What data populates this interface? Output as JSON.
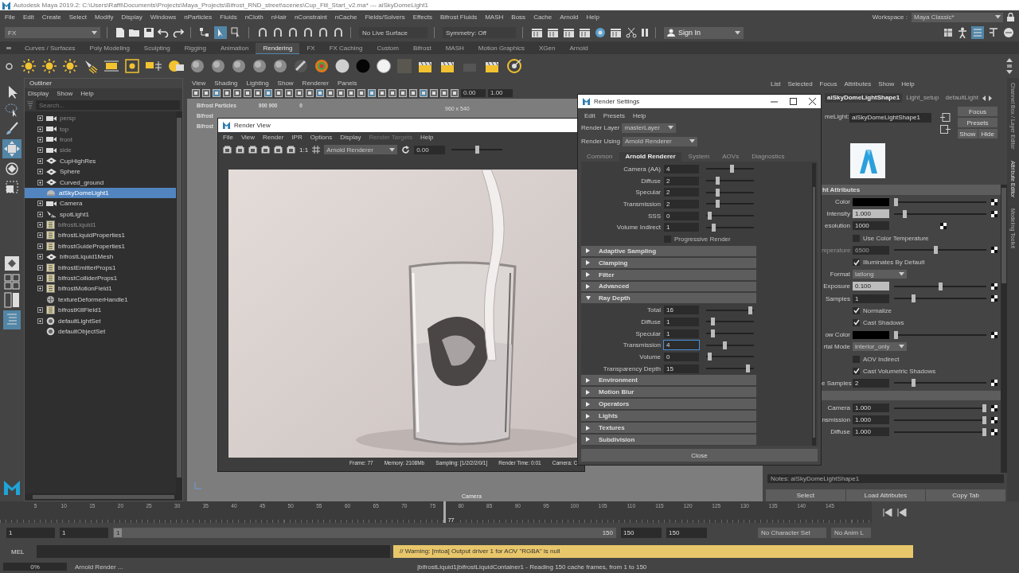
{
  "window": {
    "title": "Autodesk Maya 2019.2: C:\\Users\\Raffi\\Documents\\Projects\\Maya_Projects\\Bifrost_RND_street\\scenes\\Cup_Fill_Start_v2.ma*   ---   aiSkyDomeLight1"
  },
  "menu": [
    "File",
    "Edit",
    "Create",
    "Select",
    "Modify",
    "Display",
    "Windows",
    "nParticles",
    "Fluids",
    "nCloth",
    "nHair",
    "nConstraint",
    "nCache",
    "Fields/Solvers",
    "Effects",
    "Bifrost Fluids",
    "MASH",
    "Boss",
    "Cache",
    "Arnold",
    "Help"
  ],
  "workspace": {
    "label": "Workspace :",
    "value": "Maya Classic*"
  },
  "status_line": {
    "mode": "FX",
    "live_surface": "No Live Surface",
    "symmetry": "Symmetry: Off",
    "sign_in": "Sign In"
  },
  "shelf_tabs": [
    {
      "label": "Curves / Surfaces",
      "selected": false
    },
    {
      "label": "Poly Modeling",
      "selected": false
    },
    {
      "label": "Sculpting",
      "selected": false
    },
    {
      "label": "Rigging",
      "selected": false
    },
    {
      "label": "Animation",
      "selected": false
    },
    {
      "label": "Rendering",
      "selected": true
    },
    {
      "label": "FX",
      "selected": false
    },
    {
      "label": "FX Caching",
      "selected": false
    },
    {
      "label": "Custom",
      "selected": false
    },
    {
      "label": "Bifrost",
      "selected": false
    },
    {
      "label": "MASH",
      "selected": false
    },
    {
      "label": "Motion Graphics",
      "selected": false
    },
    {
      "label": "XGen",
      "selected": false
    },
    {
      "label": "Arnold",
      "selected": false
    }
  ],
  "outliner": {
    "title": "Outliner",
    "menu": [
      "Display",
      "Show",
      "Help"
    ],
    "search": {
      "placeholder": "Search..."
    },
    "items": [
      {
        "label": "persp",
        "kind": "camera",
        "dim": true,
        "selected": false,
        "expandable": true
      },
      {
        "label": "top",
        "kind": "camera",
        "dim": true,
        "selected": false,
        "expandable": true
      },
      {
        "label": "front",
        "kind": "camera",
        "dim": true,
        "selected": false,
        "expandable": true
      },
      {
        "label": "side",
        "kind": "camera",
        "dim": true,
        "selected": false,
        "expandable": true
      },
      {
        "label": "CupHighRes",
        "kind": "mesh",
        "dim": false,
        "selected": false,
        "expandable": true
      },
      {
        "label": "Sphere",
        "kind": "mesh",
        "dim": false,
        "selected": false,
        "expandable": true
      },
      {
        "label": "Curved_ground",
        "kind": "mesh",
        "dim": false,
        "selected": false,
        "expandable": true
      },
      {
        "label": "aiSkyDomeLight1",
        "kind": "dome",
        "dim": false,
        "selected": true,
        "expandable": false
      },
      {
        "label": "Camera",
        "kind": "camera",
        "dim": false,
        "selected": false,
        "expandable": true
      },
      {
        "label": "spotLight1",
        "kind": "spot",
        "dim": false,
        "selected": false,
        "expandable": true
      },
      {
        "label": "bifrostLiquid1",
        "kind": "bifrost",
        "dim": true,
        "selected": false,
        "expandable": true
      },
      {
        "label": "bifrostLiquidProperties1",
        "kind": "bifrost",
        "dim": false,
        "selected": false,
        "expandable": true
      },
      {
        "label": "bifrostGuideProperties1",
        "kind": "bifrost",
        "dim": false,
        "selected": false,
        "expandable": true
      },
      {
        "label": "bifrostLiquid1Mesh",
        "kind": "mesh",
        "dim": false,
        "selected": false,
        "expandable": true
      },
      {
        "label": "bifrostEmitterProps1",
        "kind": "bifrost",
        "dim": false,
        "selected": false,
        "expandable": true
      },
      {
        "label": "bifrostColliderProps1",
        "kind": "bifrost",
        "dim": false,
        "selected": false,
        "expandable": true
      },
      {
        "label": "bifrostMotionField1",
        "kind": "bifrost",
        "dim": false,
        "selected": false,
        "expandable": true
      },
      {
        "label": "textureDeformerHandle1",
        "kind": "handle",
        "dim": false,
        "selected": false,
        "expandable": false
      },
      {
        "label": "bifrostKillField1",
        "kind": "bifrost",
        "dim": false,
        "selected": false,
        "expandable": true
      },
      {
        "label": "defaultLightSet",
        "kind": "set",
        "dim": false,
        "selected": false,
        "expandable": true
      },
      {
        "label": "defaultObjectSet",
        "kind": "set",
        "dim": false,
        "selected": false,
        "expandable": false
      }
    ]
  },
  "viewport": {
    "menu": [
      "View",
      "Shading",
      "Lighting",
      "Show",
      "Renderer",
      "Panels"
    ],
    "fields": [
      "0.00",
      "1.00"
    ],
    "hud": [
      {
        "label": "Bifrost Particles",
        "values": [
          "900 900",
          "0"
        ]
      },
      {
        "label": "Bifrost"
      },
      {
        "label": "Bifrost"
      }
    ],
    "resolution": "960 x 540",
    "camera": "Camera"
  },
  "render_view": {
    "title": "Render View",
    "menu": [
      {
        "label": "File",
        "disabled": false
      },
      {
        "label": "View",
        "disabled": false
      },
      {
        "label": "Render",
        "disabled": false
      },
      {
        "label": "IPR",
        "disabled": false
      },
      {
        "label": "Options",
        "disabled": false
      },
      {
        "label": "Display",
        "disabled": false
      },
      {
        "label": "Render Targets",
        "disabled": true
      },
      {
        "label": "Help",
        "disabled": false
      }
    ],
    "ratio": "1:1",
    "renderer": "Arnold Renderer",
    "value": "0.00",
    "level": 0.5,
    "status": [
      "Frame: 77",
      "Memory: 2108Mb",
      "Sampling: [1/2/2/2/0/1]",
      "Render Time: 0:01",
      "Camera: C"
    ]
  },
  "render_settings": {
    "title": "Render Settings",
    "menu": [
      "Edit",
      "Presets",
      "Help"
    ],
    "layer": {
      "label": "Render Layer",
      "value": "masterLayer"
    },
    "using": {
      "label": "Render Using",
      "value": "Arnold Renderer"
    },
    "tabs": [
      {
        "label": "Common",
        "selected": false
      },
      {
        "label": "Arnold Renderer",
        "selected": true
      },
      {
        "label": "System",
        "selected": false
      },
      {
        "label": "AOVs",
        "selected": false
      },
      {
        "label": "Diagnostics",
        "selected": false
      }
    ],
    "rows": [
      {
        "kind": "field",
        "label": "Camera (AA)",
        "value": "4",
        "level": 0.55,
        "focused": false
      },
      {
        "kind": "field",
        "label": "Diffuse",
        "value": "2",
        "level": 0.22,
        "focused": false
      },
      {
        "kind": "field",
        "label": "Specular",
        "value": "2",
        "level": 0.22,
        "focused": false
      },
      {
        "kind": "field",
        "label": "Transmission",
        "value": "2",
        "level": 0.22,
        "focused": false
      },
      {
        "kind": "field",
        "label": "SSS",
        "value": "0",
        "level": 0.03,
        "focused": false
      },
      {
        "kind": "field",
        "label": "Volume Indirect",
        "value": "1",
        "level": 0.13,
        "focused": false
      },
      {
        "kind": "checkbox",
        "label": "Progressive Render",
        "checked": false
      },
      {
        "kind": "section",
        "label": "Adaptive Sampling",
        "expanded": false
      },
      {
        "kind": "section",
        "label": "Clamping",
        "expanded": false
      },
      {
        "kind": "section",
        "label": "Filter",
        "expanded": false
      },
      {
        "kind": "section",
        "label": "Advanced",
        "expanded": false
      },
      {
        "kind": "section",
        "label": "Ray Depth",
        "expanded": true
      },
      {
        "kind": "field",
        "label": "Total",
        "value": "16",
        "level": 0.97,
        "focused": false
      },
      {
        "kind": "field",
        "label": "Diffuse",
        "value": "1",
        "level": 0.1,
        "focused": false
      },
      {
        "kind": "field",
        "label": "Specular",
        "value": "1",
        "level": 0.1,
        "focused": false
      },
      {
        "kind": "field",
        "label": "Transmission",
        "value": "4",
        "level": 0.38,
        "focused": true
      },
      {
        "kind": "field",
        "label": "Volume",
        "value": "0",
        "level": 0.03,
        "focused": false
      },
      {
        "kind": "field",
        "label": "Transparency Depth",
        "value": "15",
        "level": 0.9,
        "focused": false
      },
      {
        "kind": "section",
        "label": "Environment",
        "expanded": false
      },
      {
        "kind": "section",
        "label": "Motion Blur",
        "expanded": false
      },
      {
        "kind": "section",
        "label": "Operators",
        "expanded": false
      },
      {
        "kind": "section",
        "label": "Lights",
        "expanded": false
      },
      {
        "kind": "section",
        "label": "Textures",
        "expanded": false
      },
      {
        "kind": "section",
        "label": "Subdivision",
        "expanded": false
      }
    ],
    "close": "Close"
  },
  "attribute_editor": {
    "menu": [
      "List",
      "Selected",
      "Focus",
      "Attributes",
      "Show",
      "Help"
    ],
    "tabs": [
      {
        "label": "aiSkyDomeLightShape1",
        "selected": true
      },
      {
        "label": "Light_setup",
        "selected": false
      },
      {
        "label": "defaultLight",
        "selected": false
      }
    ],
    "node": {
      "label": "meLight:",
      "value": "aiSkyDomeLightShape1"
    },
    "buttons": [
      "Focus",
      "Presets",
      "Show",
      "Hide"
    ],
    "section": "ht Attributes",
    "rows": [
      {
        "kind": "color",
        "label": "Color",
        "color": "#000000",
        "level": 0.0
      },
      {
        "kind": "field",
        "label": "Intensity",
        "value": "1.000",
        "level": 0.1,
        "connected": true,
        "disabled": false
      },
      {
        "kind": "field",
        "label": "esolution",
        "value": "1000",
        "connected": false,
        "disabled": false
      },
      {
        "kind": "checkbox",
        "label": "Use Color Temperature",
        "checked": false
      },
      {
        "kind": "field",
        "label": "mperature",
        "value": "6500",
        "level": 0.45,
        "connected": false,
        "disabled": true
      },
      {
        "kind": "checkbox",
        "label": "Illuminates By Default",
        "checked": true
      },
      {
        "kind": "dropdown",
        "label": "Format",
        "value": "latlong"
      },
      {
        "kind": "field",
        "label": "Exposure",
        "value": "0.100",
        "level": 0.5,
        "connected": true,
        "disabled": false
      },
      {
        "kind": "field",
        "label": "Samples",
        "value": "1",
        "level": 0.2,
        "connected": false,
        "disabled": false
      },
      {
        "kind": "checkbox",
        "label": "Normalize",
        "checked": true
      },
      {
        "kind": "checkbox",
        "label": "Cast Shadows",
        "checked": true
      },
      {
        "kind": "color",
        "label": "ow Color",
        "color": "#000000",
        "level": 0.0
      },
      {
        "kind": "dropdown",
        "label": "rtal Mode",
        "value": "interior_only"
      },
      {
        "kind": "checkbox",
        "label": "AOV Indirect",
        "checked": false
      },
      {
        "kind": "checkbox",
        "label": "Cast Volumetric Shadows",
        "checked": true
      },
      {
        "kind": "field",
        "label": "e Samples",
        "value": "2",
        "level": 0.2,
        "connected": false,
        "disabled": false
      },
      {
        "kind": "bar"
      },
      {
        "kind": "field",
        "label": "Camera",
        "value": "1.000",
        "level": 1.0,
        "connected": false,
        "disabled": false
      },
      {
        "kind": "field",
        "label": "nsmission",
        "value": "1.000",
        "level": 1.0,
        "connected": false,
        "disabled": false
      },
      {
        "kind": "field",
        "label": "Diffuse",
        "value": "1.000",
        "level": 1.0,
        "connected": false,
        "disabled": false
      }
    ],
    "notes": "Notes:  aiSkyDomeLightShape1",
    "footer_buttons": [
      "Select",
      "Load Attributes",
      "Copy Tab"
    ]
  },
  "side_tabs": [
    "Channel Box / Layer Editor",
    "Attribute Editor",
    "Modeling Toolkit"
  ],
  "timeline": {
    "ticks": [
      "5",
      "10",
      "15",
      "20",
      "25",
      "30",
      "35",
      "40",
      "45",
      "50",
      "55",
      "60",
      "65",
      "70",
      "75",
      "80",
      "85",
      "90",
      "95",
      "100",
      "105",
      "110",
      "115",
      "120",
      "125",
      "130",
      "135",
      "140",
      "145"
    ],
    "current": "77"
  },
  "range": {
    "start": "1",
    "range_start": "1",
    "slider_start": "1",
    "slider_end": "150",
    "range_end": "150",
    "end": "150",
    "level": 1.0,
    "character_set": "No Character Set",
    "anim_layer": "No Anim L"
  },
  "command_line": {
    "language": "MEL",
    "warning": "// Warning: [mtoa] Output driver 1 for AOV \"RGBA\" is null"
  },
  "help_line": {
    "progress": "0%",
    "level": 0.0,
    "task": "Arnold Render ...",
    "message": "|bifrostLiquid1|bifrostLiquidContainer1 - Reading 150 cache frames, from 1 to 150"
  }
}
